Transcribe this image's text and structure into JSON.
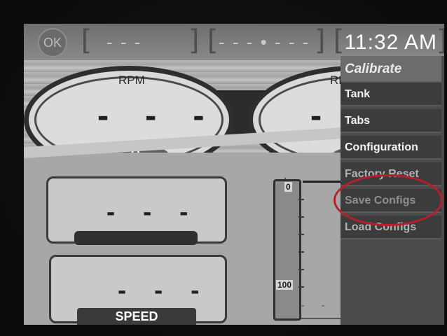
{
  "topbar": {
    "ok_label": "OK",
    "slot1": "- - -",
    "slot2": "- - - • - - -",
    "clock": "11:32 AM"
  },
  "gauges": {
    "rpm_label": "RPM",
    "rpm_value": "- - -",
    "gear": "P",
    "right_label": "RF",
    "right_value": "- -"
  },
  "panels": {
    "upper_value": "- - -",
    "speed_value": "- - -",
    "speed_label": "SPEED"
  },
  "tank": {
    "top_label": "0",
    "bottom_label": "100",
    "bottom_dashes": "- - -"
  },
  "menu": {
    "title": "Calibrate",
    "items": [
      {
        "label": "Tank",
        "state": "enabled"
      },
      {
        "label": "Tabs",
        "state": "enabled"
      },
      {
        "label": "Configuration",
        "state": "enabled"
      },
      {
        "label": "Factory Reset",
        "state": "faded"
      },
      {
        "label": "Save Configs",
        "state": "disabled"
      },
      {
        "label": "Load Configs",
        "state": "faded"
      }
    ]
  },
  "colors": {
    "highlight_circle": "#b81f2a"
  }
}
